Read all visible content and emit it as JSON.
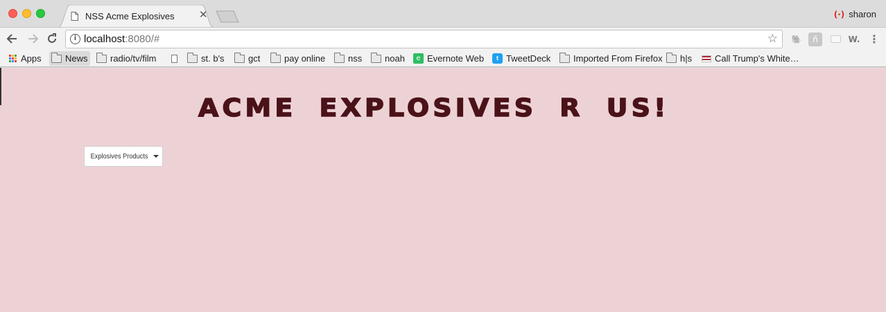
{
  "window": {
    "tab": {
      "title": "NSS Acme Explosives",
      "close_glyph": "✕"
    },
    "profile": {
      "name": "sharon",
      "icon": "profile-sync-icon"
    }
  },
  "toolbar": {
    "url_host": "localhost",
    "url_rest": ":8080/#",
    "info_glyph": "i",
    "star_glyph": "☆",
    "extensions": [
      {
        "name": "evernote-extension-icon",
        "glyph": "🐘"
      },
      {
        "name": "lastpass-extension-icon",
        "glyph": "ñ"
      },
      {
        "name": "blank-extension-icon",
        "glyph": ""
      },
      {
        "name": "w-extension-icon",
        "glyph": "W."
      },
      {
        "name": "menu-icon",
        "glyph": "⋮"
      }
    ]
  },
  "bookmarks": [
    {
      "label": "Apps",
      "icon": "apps"
    },
    {
      "label": "News",
      "icon": "folder"
    },
    {
      "label": "radio/tv/film",
      "icon": "folder"
    },
    {
      "label": "",
      "icon": "page"
    },
    {
      "label": "st. b's",
      "icon": "folder"
    },
    {
      "label": "gct",
      "icon": "folder"
    },
    {
      "label": "pay online",
      "icon": "folder"
    },
    {
      "label": "nss",
      "icon": "folder"
    },
    {
      "label": "noah",
      "icon": "folder"
    },
    {
      "label": "Evernote Web",
      "icon": "evernote"
    },
    {
      "label": "TweetDeck",
      "icon": "tweetdeck"
    },
    {
      "label": "Imported From Firefox",
      "icon": "folder"
    },
    {
      "label": "h|s",
      "icon": "folder"
    },
    {
      "label": "Call Trump's White…",
      "icon": "flag"
    }
  ],
  "page": {
    "heading": "ACME EXPLOSIVES R US!",
    "dropdown_label": "Explosives Products",
    "background": "#edd2d5",
    "heading_color": "#4a1219"
  }
}
